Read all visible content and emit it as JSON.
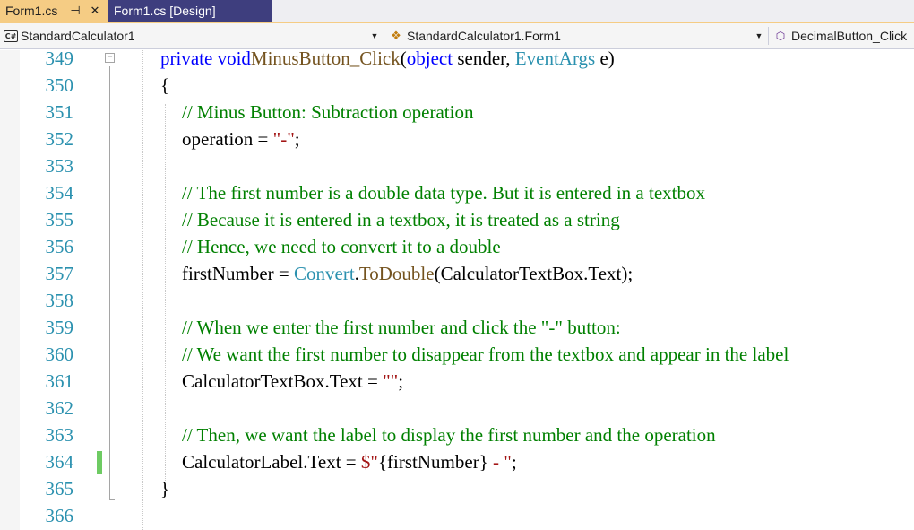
{
  "tabs": [
    {
      "label": "Form1.cs",
      "active": true,
      "pin": "⊣",
      "close": "✕"
    },
    {
      "label": "Form1.cs [Design]",
      "active": false
    }
  ],
  "navbar": {
    "project_icon": "C#",
    "project": "StandardCalculator1",
    "class": "StandardCalculator1.Form1",
    "member": "DecimalButton_Click"
  },
  "colors": {
    "keyword": "#0000ff",
    "type": "#2b91af",
    "method": "#74531f",
    "string": "#a31515",
    "comment": "#008000",
    "line_number": "#2b91af",
    "active_tab": "#f5cc84",
    "inactive_tab": "#3e3e7e",
    "change_marker": "#6ecb63"
  },
  "lines": [
    {
      "n": "349",
      "segs": [
        [
          "kw",
          "private"
        ],
        [
          "",
          "  "
        ],
        [
          "kw",
          "void"
        ],
        [
          "",
          "",
          " "
        ],
        [
          "mth",
          "MinusButton_Click"
        ],
        [
          "",
          "("
        ],
        [
          "kw",
          "object"
        ],
        [
          "",
          " sender, "
        ],
        [
          "ty",
          "EventArgs"
        ],
        [
          "",
          " e)"
        ]
      ]
    },
    {
      "n": "350",
      "segs": [
        [
          "",
          "{"
        ]
      ]
    },
    {
      "n": "351",
      "segs": [
        [
          "cm",
          "// Minus Button: Subtraction operation"
        ]
      ]
    },
    {
      "n": "352",
      "segs": [
        [
          "",
          "operation = "
        ],
        [
          "str",
          "\"-\""
        ],
        [
          "",
          ";"
        ]
      ]
    },
    {
      "n": "353",
      "segs": []
    },
    {
      "n": "354",
      "segs": [
        [
          "cm",
          "// The first number is a double data type. But it is entered in a textbox"
        ]
      ]
    },
    {
      "n": "355",
      "segs": [
        [
          "cm",
          "// Because it is entered in a textbox, it is treated as a string"
        ]
      ]
    },
    {
      "n": "356",
      "segs": [
        [
          "cm",
          "// Hence, we need to convert it to a double"
        ]
      ]
    },
    {
      "n": "357",
      "segs": [
        [
          "",
          "firstNumber = "
        ],
        [
          "ty",
          "Convert"
        ],
        [
          "",
          "."
        ],
        [
          "mth",
          "ToDouble"
        ],
        [
          "",
          "(CalculatorTextBox.Text);"
        ]
      ]
    },
    {
      "n": "358",
      "segs": []
    },
    {
      "n": "359",
      "segs": [
        [
          "cm",
          "// When we enter the first number and click the \"-\" button:"
        ]
      ]
    },
    {
      "n": "360",
      "segs": [
        [
          "cm",
          "// We want the first number to disappear from the textbox and appear in the label"
        ]
      ]
    },
    {
      "n": "361",
      "segs": [
        [
          "",
          "CalculatorTextBox.Text = "
        ],
        [
          "str",
          "\"\""
        ],
        [
          "",
          ";"
        ]
      ]
    },
    {
      "n": "362",
      "segs": []
    },
    {
      "n": "363",
      "segs": [
        [
          "cm",
          "// Then, we want the label to display the first number and the operation"
        ]
      ]
    },
    {
      "n": "364",
      "segs": [
        [
          "",
          "CalculatorLabel.Text = "
        ],
        [
          "str",
          "$\""
        ],
        [
          "",
          "{firstNumber}"
        ],
        [
          "str",
          " - \""
        ],
        [
          "",
          ";"
        ]
      ]
    },
    {
      "n": "365",
      "segs": [
        [
          "",
          "}"
        ]
      ]
    },
    {
      "n": "366",
      "segs": []
    }
  ]
}
